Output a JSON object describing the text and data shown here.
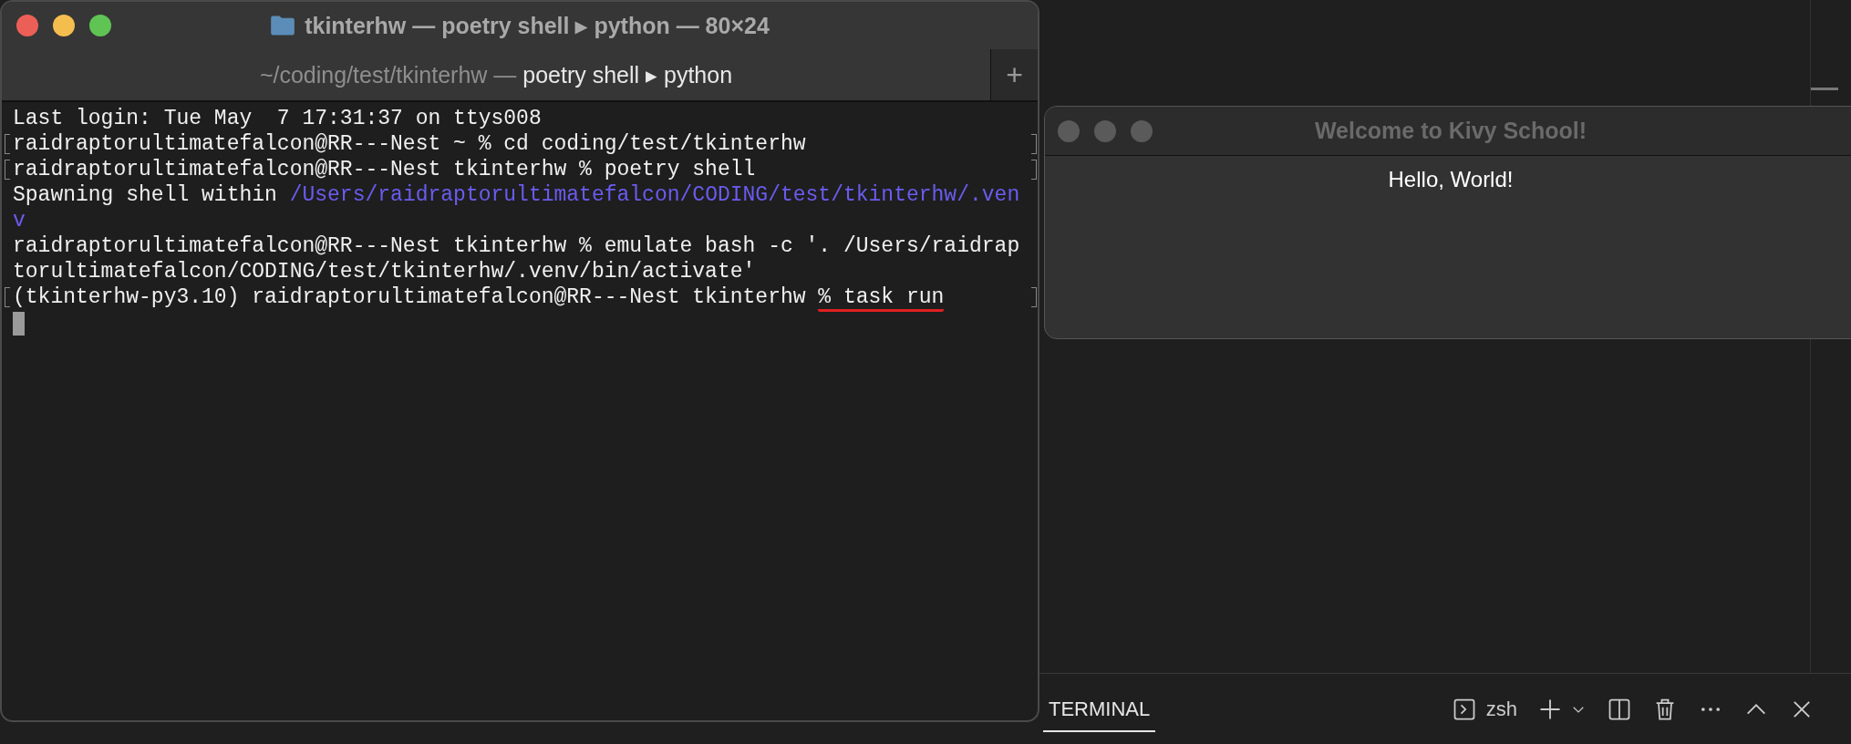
{
  "terminal_window": {
    "title": "tkinterhw — poetry shell ▸ python — 80×24",
    "tab": {
      "path": "~/coding/test/tkinterhw —",
      "process": "poetry shell ▸ python"
    },
    "new_tab": "+",
    "lines": [
      {
        "marked": false,
        "segments": [
          {
            "kind": "plain",
            "text": "Last login: Tue May  7 17:31:37 on ttys008"
          }
        ]
      },
      {
        "marked": true,
        "segments": [
          {
            "kind": "plain",
            "text": "raidraptorultimatefalcon@RR---Nest ~ % cd coding/test/tkinterhw"
          }
        ]
      },
      {
        "marked": true,
        "segments": [
          {
            "kind": "plain",
            "text": "raidraptorultimatefalcon@RR---Nest tkinterhw % poetry shell"
          }
        ]
      },
      {
        "marked": false,
        "segments": [
          {
            "kind": "plain",
            "text": "Spawning shell within "
          },
          {
            "kind": "path",
            "text": "/Users/raidraptorultimatefalcon/CODING/test/tkinterhw/.ven"
          }
        ]
      },
      {
        "marked": false,
        "segments": [
          {
            "kind": "path",
            "text": "v"
          }
        ]
      },
      {
        "marked": false,
        "segments": [
          {
            "kind": "plain",
            "text": "raidraptorultimatefalcon@RR---Nest tkinterhw % emulate bash -c '. /Users/raidrap"
          }
        ]
      },
      {
        "marked": false,
        "segments": [
          {
            "kind": "plain",
            "text": "torultimatefalcon/CODING/test/tkinterhw/.venv/bin/activate'"
          }
        ]
      },
      {
        "marked": true,
        "segments": [
          {
            "kind": "plain",
            "text": "(tkinterhw-py3.10) raidraptorultimatefalcon@RR---Nest tkinterhw "
          },
          {
            "kind": "annotated",
            "text": "% task run"
          }
        ]
      }
    ],
    "cursor": true
  },
  "kivy_window": {
    "title": "Welcome to Kivy School!",
    "label": "Hello, World!"
  },
  "editor_panel": {
    "tabs": [
      {
        "label": "TERMINAL",
        "selected": true
      }
    ],
    "shell": "zsh"
  }
}
